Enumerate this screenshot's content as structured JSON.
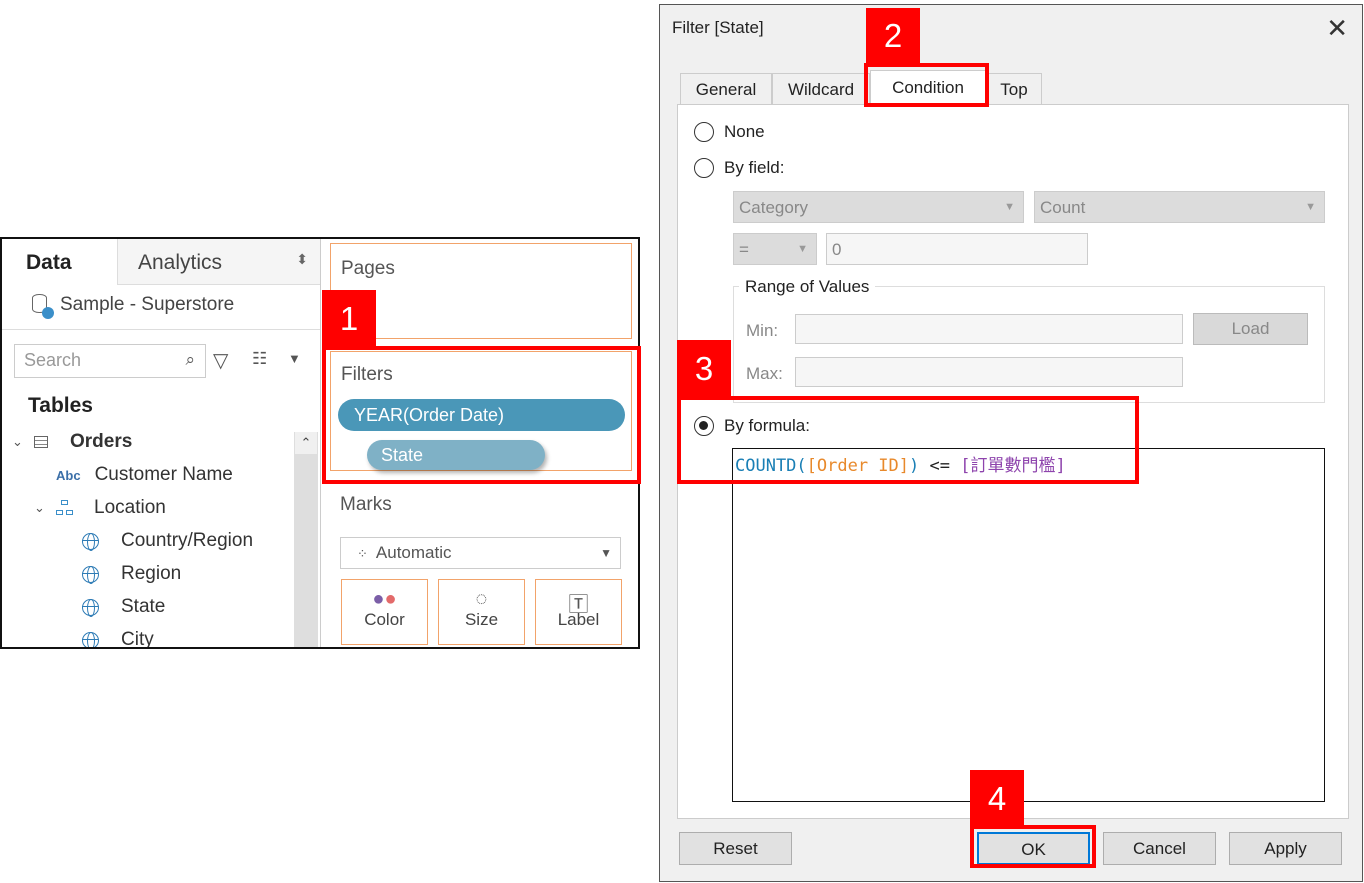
{
  "tableau": {
    "tabs": {
      "data": "Data",
      "analytics": "Analytics"
    },
    "datasource": "Sample - Superstore",
    "search_placeholder": "Search",
    "tables_heading": "Tables",
    "tree": {
      "orders": "Orders",
      "customer_name": "Customer Name",
      "abc_tag": "Abc",
      "location": "Location",
      "country_region": "Country/Region",
      "region": "Region",
      "state": "State",
      "city": "City"
    },
    "shelves": {
      "pages": "Pages",
      "filters": "Filters",
      "marks": "Marks"
    },
    "filter_pills": [
      "YEAR(Order Date)",
      "State"
    ],
    "marks_type": "Automatic",
    "mark_buttons": {
      "color": "Color",
      "size": "Size",
      "label": "Label"
    }
  },
  "annotations": {
    "step1": "1",
    "step2": "2",
    "step3": "3",
    "step4": "4",
    "color": "#ff0000"
  },
  "dialog": {
    "title": "Filter [State]",
    "tabs": [
      "General",
      "Wildcard",
      "Condition",
      "Top"
    ],
    "active_tab": "Condition",
    "options": {
      "none": "None",
      "by_field": "By field:",
      "by_formula": "By formula:"
    },
    "selected_option": "By formula:",
    "by_field": {
      "field": "Category",
      "aggregation": "Count",
      "operator": "=",
      "value": "0"
    },
    "range": {
      "title": "Range of Values",
      "min_label": "Min:",
      "max_label": "Max:",
      "load": "Load"
    },
    "formula": {
      "func": "COUNTD(",
      "field": "[Order ID]",
      "close": ")",
      "op": " <= ",
      "param": "[訂單數門檻]"
    },
    "buttons": {
      "reset": "Reset",
      "ok": "OK",
      "cancel": "Cancel",
      "apply": "Apply"
    }
  },
  "colors": {
    "pill_year": "#4a97b8",
    "pill_state": "#7fb1c6",
    "shelf_border": "#f2a36a",
    "formula_func": "#1a7fb5",
    "formula_field": "#e8892b",
    "formula_param": "#8e44ad"
  }
}
